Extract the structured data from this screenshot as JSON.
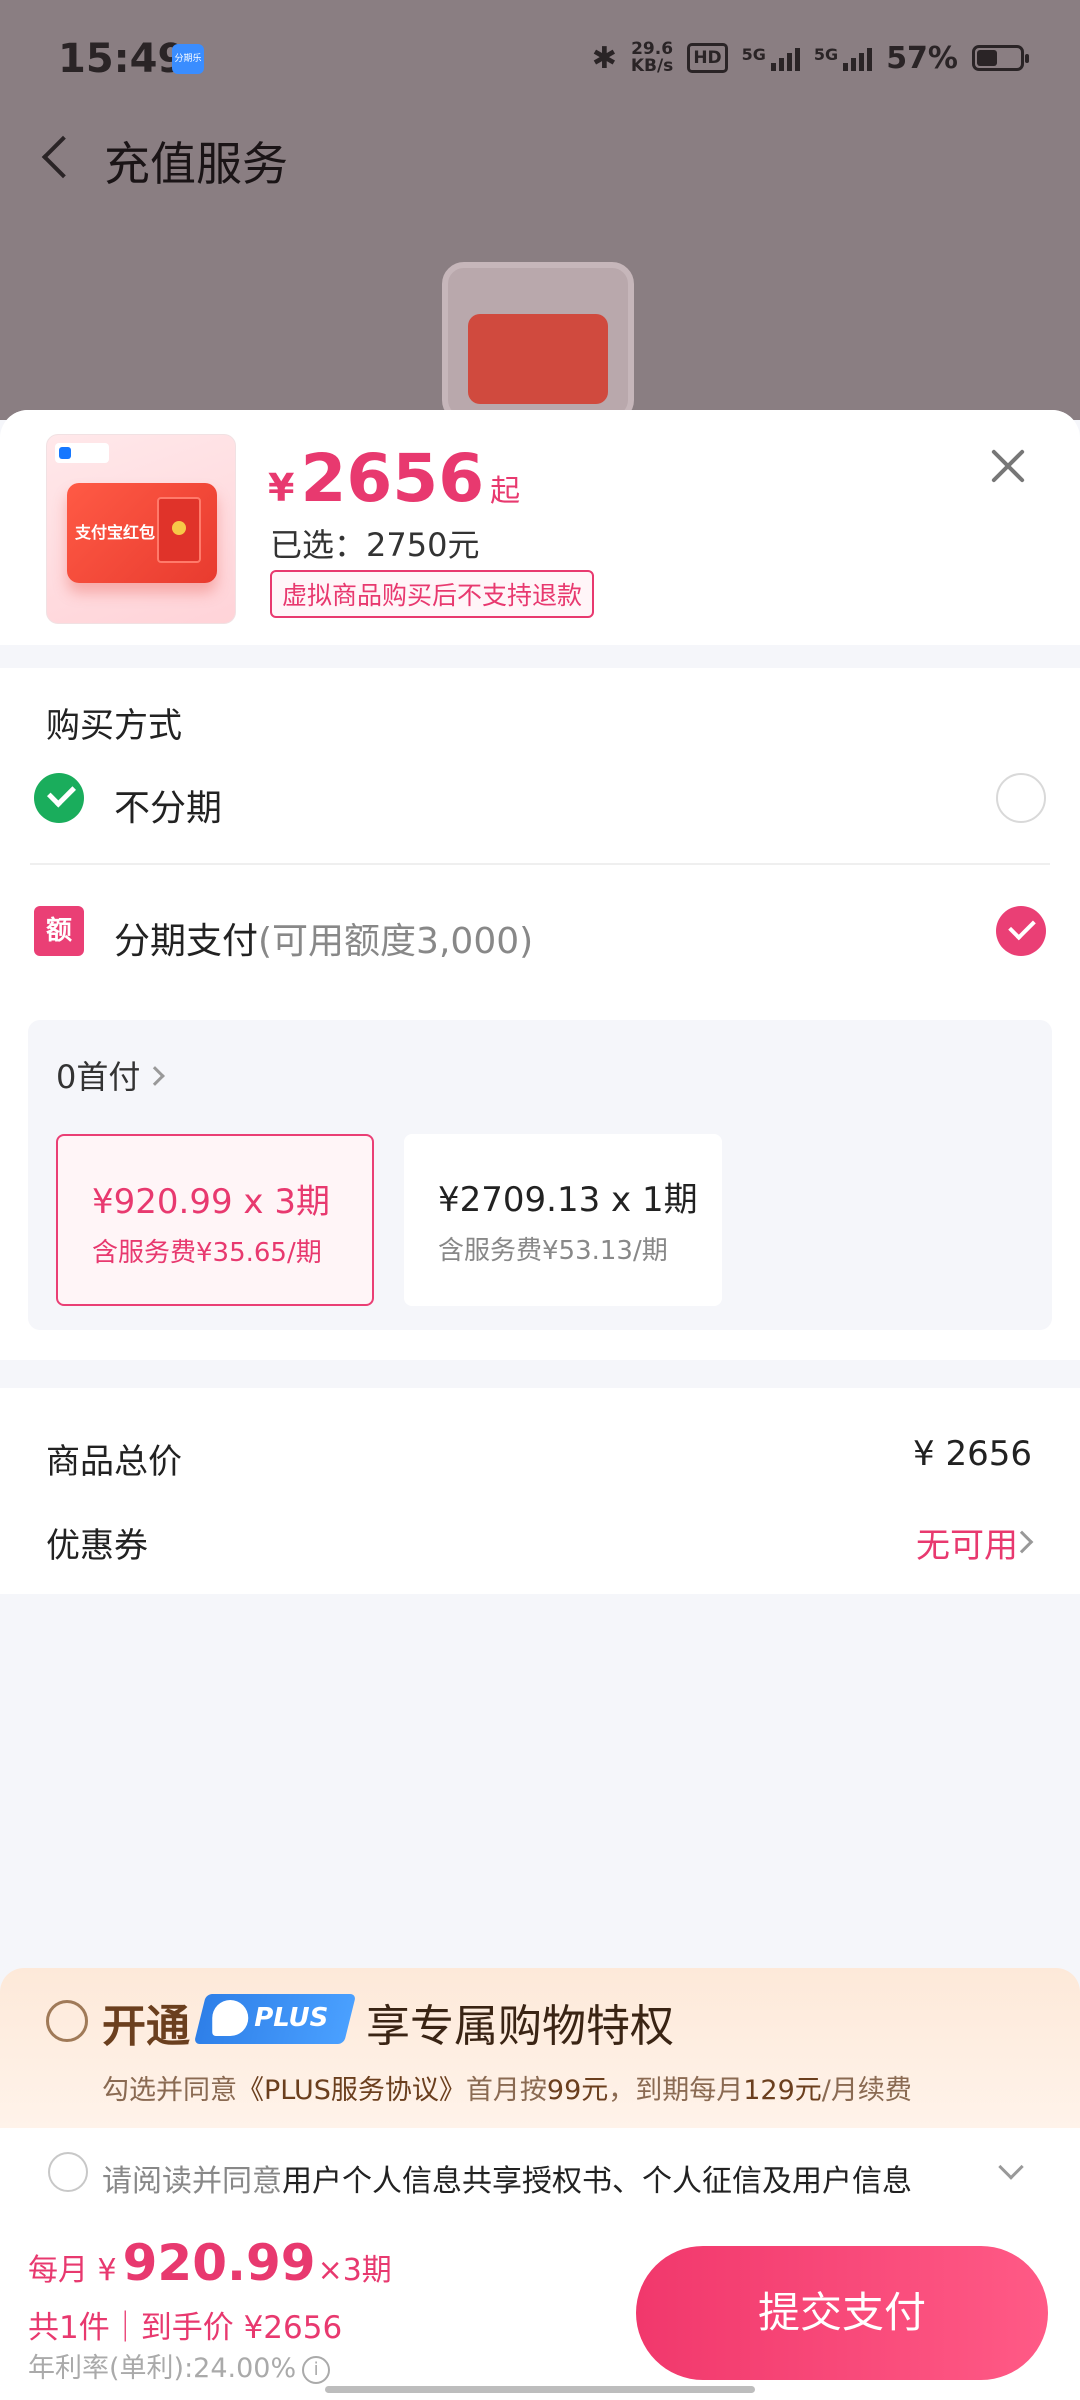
{
  "status_bar": {
    "time": "15:49",
    "app_badge": "分期乐",
    "net_speed_value": "29.6",
    "net_speed_unit": "KB/s",
    "hd_badge": "HD",
    "sim1_label": "5G",
    "sim2_label": "5G",
    "battery": "57%"
  },
  "background_page": {
    "title": "充值服务",
    "product_card_text": "支付宝红包"
  },
  "product": {
    "currency": "¥",
    "price": "2656",
    "price_suffix": "起",
    "selected": "已选：2750元",
    "refund_notice": "虚拟商品购买后不支持退款",
    "thumb_text": "支付宝红包"
  },
  "payment": {
    "section_title": "购买方式",
    "options": [
      {
        "label": "不分期",
        "sub": "",
        "checked": false
      },
      {
        "label": "分期支付",
        "sub": "(可用额度3,000)",
        "checked": true
      }
    ],
    "installment_icon": "额",
    "down_payment": "0首付",
    "plans": [
      {
        "main": "¥920.99 x 3期",
        "fee": "含服务费¥35.65/期",
        "active": true
      },
      {
        "main": "¥2709.13 x 1期",
        "fee": "含服务费¥53.13/期",
        "active": false
      }
    ]
  },
  "summary": {
    "total_label": "商品总价",
    "total_value": "¥ 2656",
    "coupon_label": "优惠券",
    "coupon_value": "无可用"
  },
  "plus": {
    "open": "开通",
    "logo_text": "PLUS",
    "slogan": "享专属购物特权",
    "terms_prefix": "勾选并同意",
    "terms_link": "《PLUS服务协议》",
    "terms_mid": "首月按",
    "first_month": "99元",
    "terms_mid2": "，到期每月",
    "monthly_fee": "129元",
    "terms_end": "/月续费"
  },
  "agreement": {
    "prefix": "请阅读并同意",
    "docs": "用户个人信息共享授权书、个人征信及用户信息"
  },
  "bottom": {
    "monthly_prefix": "每月 ¥",
    "monthly_amount": "920.99",
    "monthly_suffix": "×3期",
    "total_line": "共1件｜到手价 ¥2656",
    "apr": "年利率(单利):24.00%",
    "info_icon": "i",
    "submit": "提交支付"
  },
  "colors": {
    "accent": "#ea3f75",
    "plus_brown": "#6b3f1e",
    "plus_blue": "#2e7fe8",
    "wechat_green": "#1aad5c"
  }
}
